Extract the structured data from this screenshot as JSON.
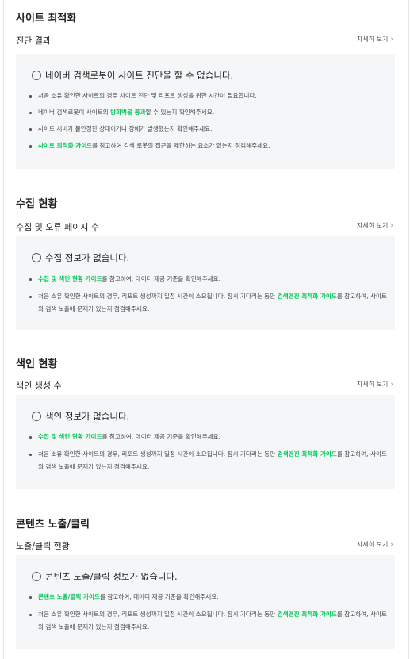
{
  "sections": [
    {
      "title": "사이트 최적화",
      "subtitle": "진단 결과",
      "more": "자세히 보기",
      "message": "네이버 검색로봇이 사이트 진단을 할 수 없습니다.",
      "bullets": [
        [
          {
            "t": "처음 소유 확인한 사이트의 경우 사이트 진단 및 리포트 생성을 위한 시간이 필요합니다."
          }
        ],
        [
          {
            "t": "네이버 검색로봇이 사이트의 "
          },
          {
            "t": "방화벽을 통과",
            "hl": true
          },
          {
            "t": "할 수 있는지 확인해주세요."
          }
        ],
        [
          {
            "t": "사이트 서버가 불안정한 상태이거나 장애가 발생했는지 확인해주세요."
          }
        ],
        [
          {
            "t": "사이트 최적화 가이드",
            "hl": true
          },
          {
            "t": "를 참고하여 검색 로봇의 접근을 제한하는 요소가 없는지 점검해주세요."
          }
        ]
      ]
    },
    {
      "title": "수집 현황",
      "subtitle": "수집 및 오류 페이지 수",
      "more": "자세히 보기",
      "message": "수집 정보가 없습니다.",
      "bullets": [
        [
          {
            "t": "수집 및 색인 현황 가이드",
            "hl": true
          },
          {
            "t": "를 참고하여, 데이터 제공 기준을 확인해주세요."
          }
        ],
        [
          {
            "t": "처음 소유 확인한 사이트의 경우, 리포트 생성까지 일정 시간이 소요됩니다. 잠시 기다리는 동안 "
          },
          {
            "t": "검색엔진 최적화 가이드",
            "hl": true
          },
          {
            "t": "를 참고하여, 사이트의 검색 노출에 문제가 있는지 점검해주세요."
          }
        ]
      ]
    },
    {
      "title": "색인 현황",
      "subtitle": "색인 생성 수",
      "more": "자세히 보기",
      "message": "색인 정보가 없습니다.",
      "bullets": [
        [
          {
            "t": "수집 및 색인 현황 가이드",
            "hl": true
          },
          {
            "t": "를 참고하여, 데이터 제공 기준을 확인해주세요."
          }
        ],
        [
          {
            "t": "처음 소유 확인한 사이트의 경우, 리포트 생성까지 일정 시간이 소요됩니다. 잠시 기다리는 동안 "
          },
          {
            "t": "검색엔진 최적화 가이드",
            "hl": true
          },
          {
            "t": "를 참고하여, 사이트의 검색 노출에 문제가 있는지 점검해주세요."
          }
        ]
      ]
    },
    {
      "title": "콘텐츠 노출/클릭",
      "subtitle": "노출/클릭 현황",
      "more": "자세히 보기",
      "message": "콘텐츠 노출/클릭 정보가 없습니다.",
      "bullets": [
        [
          {
            "t": "콘텐츠 노출/클릭 가이드",
            "hl": true
          },
          {
            "t": "를 참고하여, 데이터 제공 기준을 확인해주세요."
          }
        ],
        [
          {
            "t": "처음 소유 확인한 사이트의 경우, 리포트 생성까지 일정 시간이 소요됩니다. 잠시 기다리는 동안 "
          },
          {
            "t": "검색엔진 최적화 가이드",
            "hl": true
          },
          {
            "t": "를 참고하여, 사이트의 검색 노출에 문제가 있는지 점검해주세요."
          }
        ]
      ]
    }
  ]
}
